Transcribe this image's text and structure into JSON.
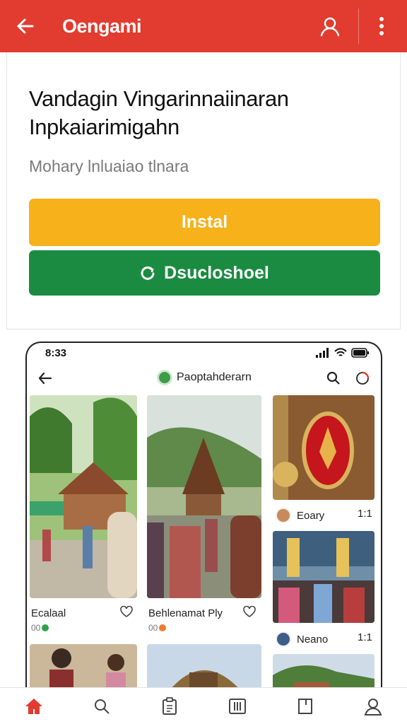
{
  "appbar": {
    "brand": "Oengami",
    "icons": {
      "back": "back-arrow-icon",
      "account": "user-icon",
      "menu": "more-vert-icon"
    }
  },
  "header": {
    "title": "Vandagin Vingarinnaiinaran Inpkaiarimigahn",
    "subtitle": "Mohary lnluaiao tlnara",
    "install_label": "Instal",
    "download_label": "Dsucloshoel"
  },
  "phone": {
    "status_time": "8:33",
    "title": "Paoptahderarn",
    "feed": [
      {
        "caption": "Ecalaal",
        "meta": "00"
      },
      {
        "caption": "Behlenamat Ply",
        "meta": "00"
      }
    ],
    "side": [
      {
        "label": "Eoary",
        "count": "1:1"
      },
      {
        "label": "Neano",
        "count": "1:1"
      }
    ]
  },
  "colors": {
    "brand_red": "#e23b2f",
    "install_yellow": "#f6b11b",
    "download_green": "#1c8b42"
  },
  "bottom_nav": [
    {
      "name": "home",
      "icon": "home-icon"
    },
    {
      "name": "search",
      "icon": "search-icon"
    },
    {
      "name": "clipboard",
      "icon": "clipboard-icon"
    },
    {
      "name": "library",
      "icon": "library-icon"
    },
    {
      "name": "bookmark",
      "icon": "bookmark-icon"
    },
    {
      "name": "profile",
      "icon": "profile-icon"
    }
  ]
}
